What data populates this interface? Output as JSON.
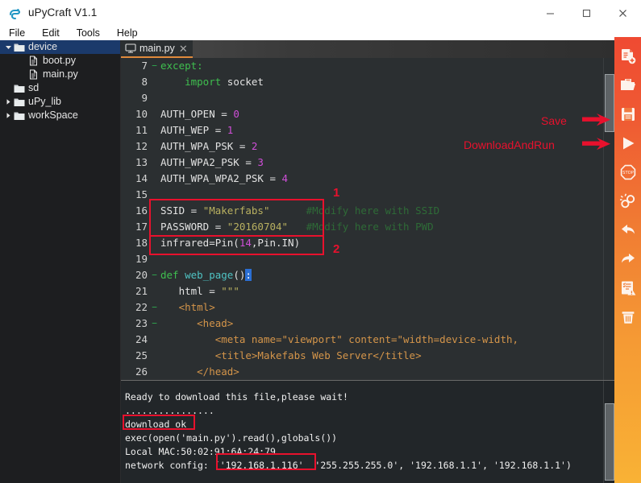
{
  "window": {
    "title": "uPyCraft V1.1",
    "app_icon": "upycraft-logo-icon",
    "minimize": "─",
    "maximize": "□",
    "close": "✕"
  },
  "menubar": {
    "items": [
      {
        "label": "File"
      },
      {
        "label": "Edit"
      },
      {
        "label": "Tools"
      },
      {
        "label": "Help"
      }
    ]
  },
  "sidebar": {
    "items": [
      {
        "label": "device",
        "icon": "folder-open-icon",
        "arrow": "triangle-down",
        "indent": 1,
        "selected": true
      },
      {
        "label": "boot.py",
        "icon": "file-icon",
        "arrow": "",
        "indent": 2,
        "selected": false
      },
      {
        "label": "main.py",
        "icon": "file-icon",
        "arrow": "",
        "indent": 2,
        "selected": false
      },
      {
        "label": "sd",
        "icon": "folder-icon",
        "arrow": "",
        "indent": 1,
        "selected": false
      },
      {
        "label": "uPy_lib",
        "icon": "folder-icon",
        "arrow": "triangle-right",
        "indent": 1,
        "selected": false
      },
      {
        "label": "workSpace",
        "icon": "folder-icon",
        "arrow": "triangle-right",
        "indent": 1,
        "selected": false
      }
    ]
  },
  "editor": {
    "tab": {
      "label": "main.py",
      "icon": "monitor-icon",
      "close": "✕"
    },
    "lines": [
      {
        "num": "7",
        "fold": "−",
        "tokens": [
          {
            "t": "except",
            "c": "kw"
          },
          {
            "t": ":",
            "c": "kw"
          }
        ]
      },
      {
        "num": "8",
        "fold": "",
        "tokens": [
          {
            "t": "    ",
            "c": "plain"
          },
          {
            "t": "import",
            "c": "kw"
          },
          {
            "t": " socket",
            "c": "plain"
          }
        ]
      },
      {
        "num": "9",
        "fold": "",
        "tokens": [
          {
            "t": "",
            "c": "plain"
          }
        ]
      },
      {
        "num": "10",
        "fold": "",
        "tokens": [
          {
            "t": "AUTH_OPEN = ",
            "c": "plain"
          },
          {
            "t": "0",
            "c": "num"
          }
        ]
      },
      {
        "num": "11",
        "fold": "",
        "tokens": [
          {
            "t": "AUTH_WEP = ",
            "c": "plain"
          },
          {
            "t": "1",
            "c": "num"
          }
        ]
      },
      {
        "num": "12",
        "fold": "",
        "tokens": [
          {
            "t": "AUTH_WPA_PSK = ",
            "c": "plain"
          },
          {
            "t": "2",
            "c": "num"
          }
        ]
      },
      {
        "num": "13",
        "fold": "",
        "tokens": [
          {
            "t": "AUTH_WPA2_PSK = ",
            "c": "plain"
          },
          {
            "t": "3",
            "c": "num"
          }
        ]
      },
      {
        "num": "14",
        "fold": "",
        "tokens": [
          {
            "t": "AUTH_WPA_WPA2_PSK = ",
            "c": "plain"
          },
          {
            "t": "4",
            "c": "num"
          }
        ]
      },
      {
        "num": "15",
        "fold": "",
        "tokens": [
          {
            "t": "",
            "c": "plain"
          }
        ]
      },
      {
        "num": "16",
        "fold": "",
        "tokens": [
          {
            "t": "SSID = ",
            "c": "plain"
          },
          {
            "t": "\"Makerfabs\"",
            "c": "str"
          },
          {
            "t": "      ",
            "c": "plain"
          },
          {
            "t": "#Modify here with SSID",
            "c": "cmt"
          }
        ]
      },
      {
        "num": "17",
        "fold": "",
        "tokens": [
          {
            "t": "PASSWORD = ",
            "c": "plain"
          },
          {
            "t": "\"20160704\"",
            "c": "str"
          },
          {
            "t": "   ",
            "c": "plain"
          },
          {
            "t": "#Modify here with PWD",
            "c": "cmt"
          }
        ]
      },
      {
        "num": "18",
        "fold": "",
        "tokens": [
          {
            "t": "infrared=Pin(",
            "c": "plain"
          },
          {
            "t": "14",
            "c": "num"
          },
          {
            "t": ",Pin.IN)",
            "c": "plain"
          }
        ]
      },
      {
        "num": "19",
        "fold": "",
        "tokens": [
          {
            "t": "",
            "c": "plain"
          }
        ]
      },
      {
        "num": "20",
        "fold": "−",
        "tokens": [
          {
            "t": "def",
            "c": "kw"
          },
          {
            "t": " ",
            "c": "plain"
          },
          {
            "t": "web_page",
            "c": "fn"
          },
          {
            "t": "()",
            "c": "plain"
          },
          {
            "t": ":",
            "c": "sel"
          }
        ]
      },
      {
        "num": "21",
        "fold": "",
        "tokens": [
          {
            "t": "   html = ",
            "c": "plain"
          },
          {
            "t": "\"\"\"",
            "c": "str"
          }
        ]
      },
      {
        "num": "22",
        "fold": "−",
        "tokens": [
          {
            "t": "   ",
            "c": "plain"
          },
          {
            "t": "<html>",
            "c": "htm"
          }
        ]
      },
      {
        "num": "23",
        "fold": "−",
        "tokens": [
          {
            "t": "      ",
            "c": "plain"
          },
          {
            "t": "<head>",
            "c": "htm"
          }
        ]
      },
      {
        "num": "24",
        "fold": "",
        "tokens": [
          {
            "t": "         ",
            "c": "plain"
          },
          {
            "t": "<meta name=\"viewport\" content=\"width=device-width,",
            "c": "htm"
          }
        ]
      },
      {
        "num": "25",
        "fold": "",
        "tokens": [
          {
            "t": "         ",
            "c": "plain"
          },
          {
            "t": "<title>Makefabs Web Server</title>",
            "c": "htm"
          }
        ]
      },
      {
        "num": "26",
        "fold": "",
        "tokens": [
          {
            "t": "      ",
            "c": "plain"
          },
          {
            "t": "</head>",
            "c": "htm"
          }
        ]
      }
    ]
  },
  "console": {
    "lines": [
      "Ready to download this file,please wait!",
      "................",
      "download ok",
      "exec(open('main.py').read(),globals())",
      "Local MAC:50:02:91:6A:24:79",
      "network config: ('192.168.1.116'  '255.255.255.0', '192.168.1.1', '192.168.1.1')"
    ]
  },
  "toolbar": {
    "buttons": [
      {
        "name": "new-file-icon",
        "label": "New File"
      },
      {
        "name": "open-folder-icon",
        "label": "Open"
      },
      {
        "name": "save-icon",
        "label": "Save"
      },
      {
        "name": "run-icon",
        "label": "DownloadAndRun"
      },
      {
        "name": "stop-icon",
        "label": "Stop"
      },
      {
        "name": "disconnect-icon",
        "label": "Disconnect"
      },
      {
        "name": "undo-icon",
        "label": "Undo"
      },
      {
        "name": "redo-icon",
        "label": "Redo"
      },
      {
        "name": "syntax-check-icon",
        "label": "Syntax Check"
      },
      {
        "name": "delete-icon",
        "label": "Delete"
      }
    ]
  },
  "annotations": {
    "save_label": "Save",
    "run_label": "DownloadAndRun",
    "num_one": "1",
    "num_two": "2",
    "accent_red": "#e8112d"
  }
}
